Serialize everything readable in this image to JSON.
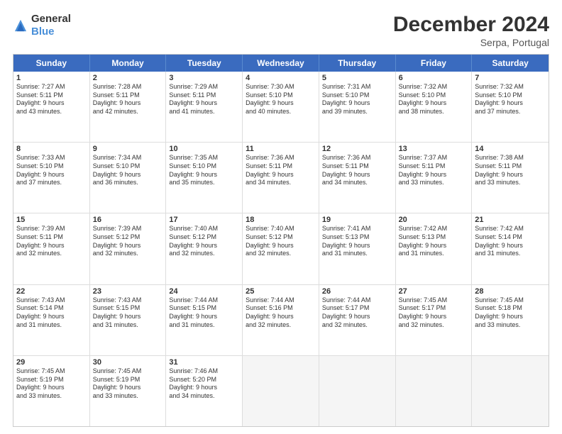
{
  "logo": {
    "general": "General",
    "blue": "Blue"
  },
  "header": {
    "month": "December 2024",
    "location": "Serpa, Portugal"
  },
  "days": [
    "Sunday",
    "Monday",
    "Tuesday",
    "Wednesday",
    "Thursday",
    "Friday",
    "Saturday"
  ],
  "weeks": [
    [
      {
        "day": "1",
        "lines": [
          "Sunrise: 7:27 AM",
          "Sunset: 5:11 PM",
          "Daylight: 9 hours",
          "and 43 minutes."
        ]
      },
      {
        "day": "2",
        "lines": [
          "Sunrise: 7:28 AM",
          "Sunset: 5:11 PM",
          "Daylight: 9 hours",
          "and 42 minutes."
        ]
      },
      {
        "day": "3",
        "lines": [
          "Sunrise: 7:29 AM",
          "Sunset: 5:11 PM",
          "Daylight: 9 hours",
          "and 41 minutes."
        ]
      },
      {
        "day": "4",
        "lines": [
          "Sunrise: 7:30 AM",
          "Sunset: 5:10 PM",
          "Daylight: 9 hours",
          "and 40 minutes."
        ]
      },
      {
        "day": "5",
        "lines": [
          "Sunrise: 7:31 AM",
          "Sunset: 5:10 PM",
          "Daylight: 9 hours",
          "and 39 minutes."
        ]
      },
      {
        "day": "6",
        "lines": [
          "Sunrise: 7:32 AM",
          "Sunset: 5:10 PM",
          "Daylight: 9 hours",
          "and 38 minutes."
        ]
      },
      {
        "day": "7",
        "lines": [
          "Sunrise: 7:32 AM",
          "Sunset: 5:10 PM",
          "Daylight: 9 hours",
          "and 37 minutes."
        ]
      }
    ],
    [
      {
        "day": "8",
        "lines": [
          "Sunrise: 7:33 AM",
          "Sunset: 5:10 PM",
          "Daylight: 9 hours",
          "and 37 minutes."
        ]
      },
      {
        "day": "9",
        "lines": [
          "Sunrise: 7:34 AM",
          "Sunset: 5:10 PM",
          "Daylight: 9 hours",
          "and 36 minutes."
        ]
      },
      {
        "day": "10",
        "lines": [
          "Sunrise: 7:35 AM",
          "Sunset: 5:10 PM",
          "Daylight: 9 hours",
          "and 35 minutes."
        ]
      },
      {
        "day": "11",
        "lines": [
          "Sunrise: 7:36 AM",
          "Sunset: 5:11 PM",
          "Daylight: 9 hours",
          "and 34 minutes."
        ]
      },
      {
        "day": "12",
        "lines": [
          "Sunrise: 7:36 AM",
          "Sunset: 5:11 PM",
          "Daylight: 9 hours",
          "and 34 minutes."
        ]
      },
      {
        "day": "13",
        "lines": [
          "Sunrise: 7:37 AM",
          "Sunset: 5:11 PM",
          "Daylight: 9 hours",
          "and 33 minutes."
        ]
      },
      {
        "day": "14",
        "lines": [
          "Sunrise: 7:38 AM",
          "Sunset: 5:11 PM",
          "Daylight: 9 hours",
          "and 33 minutes."
        ]
      }
    ],
    [
      {
        "day": "15",
        "lines": [
          "Sunrise: 7:39 AM",
          "Sunset: 5:11 PM",
          "Daylight: 9 hours",
          "and 32 minutes."
        ]
      },
      {
        "day": "16",
        "lines": [
          "Sunrise: 7:39 AM",
          "Sunset: 5:12 PM",
          "Daylight: 9 hours",
          "and 32 minutes."
        ]
      },
      {
        "day": "17",
        "lines": [
          "Sunrise: 7:40 AM",
          "Sunset: 5:12 PM",
          "Daylight: 9 hours",
          "and 32 minutes."
        ]
      },
      {
        "day": "18",
        "lines": [
          "Sunrise: 7:40 AM",
          "Sunset: 5:12 PM",
          "Daylight: 9 hours",
          "and 32 minutes."
        ]
      },
      {
        "day": "19",
        "lines": [
          "Sunrise: 7:41 AM",
          "Sunset: 5:13 PM",
          "Daylight: 9 hours",
          "and 31 minutes."
        ]
      },
      {
        "day": "20",
        "lines": [
          "Sunrise: 7:42 AM",
          "Sunset: 5:13 PM",
          "Daylight: 9 hours",
          "and 31 minutes."
        ]
      },
      {
        "day": "21",
        "lines": [
          "Sunrise: 7:42 AM",
          "Sunset: 5:14 PM",
          "Daylight: 9 hours",
          "and 31 minutes."
        ]
      }
    ],
    [
      {
        "day": "22",
        "lines": [
          "Sunrise: 7:43 AM",
          "Sunset: 5:14 PM",
          "Daylight: 9 hours",
          "and 31 minutes."
        ]
      },
      {
        "day": "23",
        "lines": [
          "Sunrise: 7:43 AM",
          "Sunset: 5:15 PM",
          "Daylight: 9 hours",
          "and 31 minutes."
        ]
      },
      {
        "day": "24",
        "lines": [
          "Sunrise: 7:44 AM",
          "Sunset: 5:15 PM",
          "Daylight: 9 hours",
          "and 31 minutes."
        ]
      },
      {
        "day": "25",
        "lines": [
          "Sunrise: 7:44 AM",
          "Sunset: 5:16 PM",
          "Daylight: 9 hours",
          "and 32 minutes."
        ]
      },
      {
        "day": "26",
        "lines": [
          "Sunrise: 7:44 AM",
          "Sunset: 5:17 PM",
          "Daylight: 9 hours",
          "and 32 minutes."
        ]
      },
      {
        "day": "27",
        "lines": [
          "Sunrise: 7:45 AM",
          "Sunset: 5:17 PM",
          "Daylight: 9 hours",
          "and 32 minutes."
        ]
      },
      {
        "day": "28",
        "lines": [
          "Sunrise: 7:45 AM",
          "Sunset: 5:18 PM",
          "Daylight: 9 hours",
          "and 33 minutes."
        ]
      }
    ],
    [
      {
        "day": "29",
        "lines": [
          "Sunrise: 7:45 AM",
          "Sunset: 5:19 PM",
          "Daylight: 9 hours",
          "and 33 minutes."
        ]
      },
      {
        "day": "30",
        "lines": [
          "Sunrise: 7:45 AM",
          "Sunset: 5:19 PM",
          "Daylight: 9 hours",
          "and 33 minutes."
        ]
      },
      {
        "day": "31",
        "lines": [
          "Sunrise: 7:46 AM",
          "Sunset: 5:20 PM",
          "Daylight: 9 hours",
          "and 34 minutes."
        ]
      },
      null,
      null,
      null,
      null
    ]
  ]
}
